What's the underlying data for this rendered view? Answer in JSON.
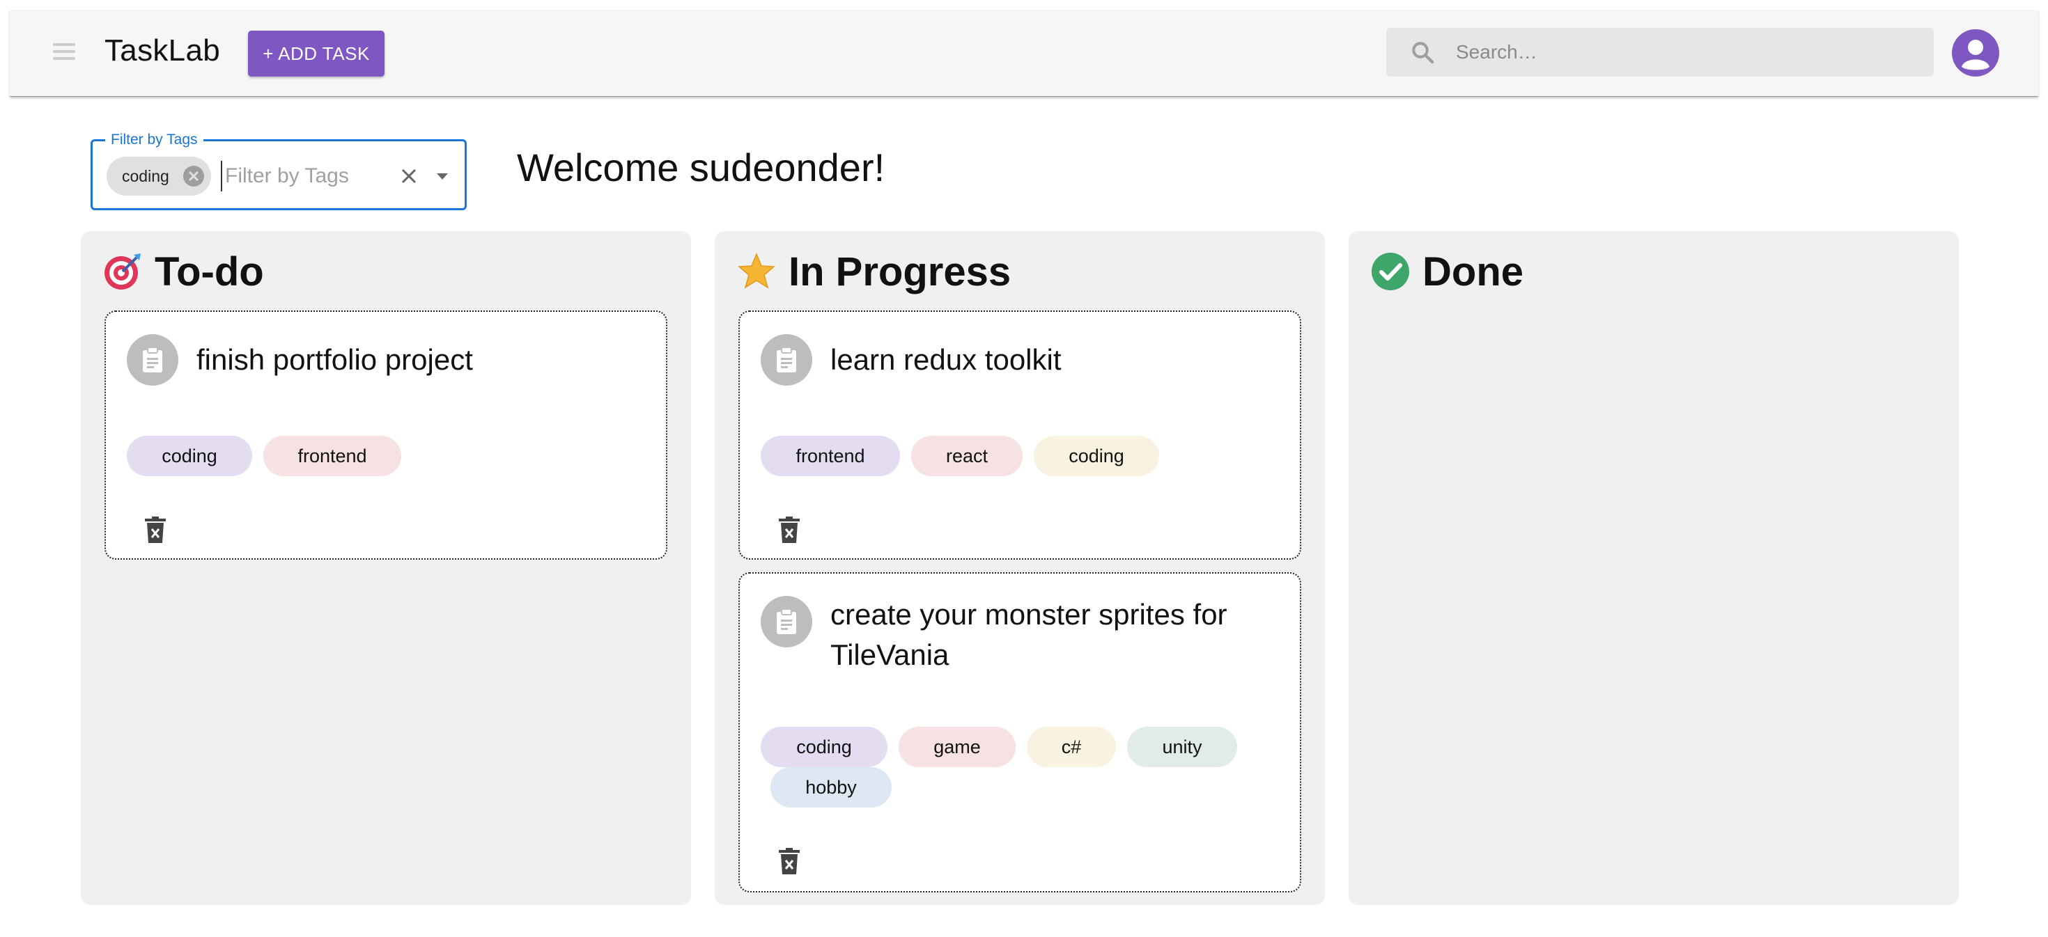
{
  "appbar": {
    "title": "TaskLab",
    "add_task_label": "+ ADD TASK",
    "search_placeholder": "Search…",
    "brand_color": "#7e57c2"
  },
  "filter": {
    "legend": "Filter by Tags",
    "selected_tag": "coding",
    "placeholder": "Filter by Tags"
  },
  "welcome": "Welcome sudeonder!",
  "columns": [
    {
      "title": "To-do",
      "icon": "target-icon",
      "cards": [
        {
          "title": "finish portfolio project",
          "tags": [
            "coding",
            "frontend"
          ]
        }
      ]
    },
    {
      "title": "In Progress",
      "icon": "star-icon",
      "cards": [
        {
          "title": "learn redux toolkit",
          "tags": [
            "frontend",
            "react",
            "coding"
          ]
        },
        {
          "title": "create your monster sprites for TileVania",
          "tags": [
            "coding",
            "game",
            "c#",
            "unity",
            "hobby"
          ]
        }
      ]
    },
    {
      "title": "Done",
      "icon": "check-circle-icon",
      "cards": []
    }
  ],
  "tag_colors": [
    "#e4ddf2",
    "#f6e1e3",
    "#f8f2e0",
    "#e1ebe8",
    "#dee8f4"
  ]
}
